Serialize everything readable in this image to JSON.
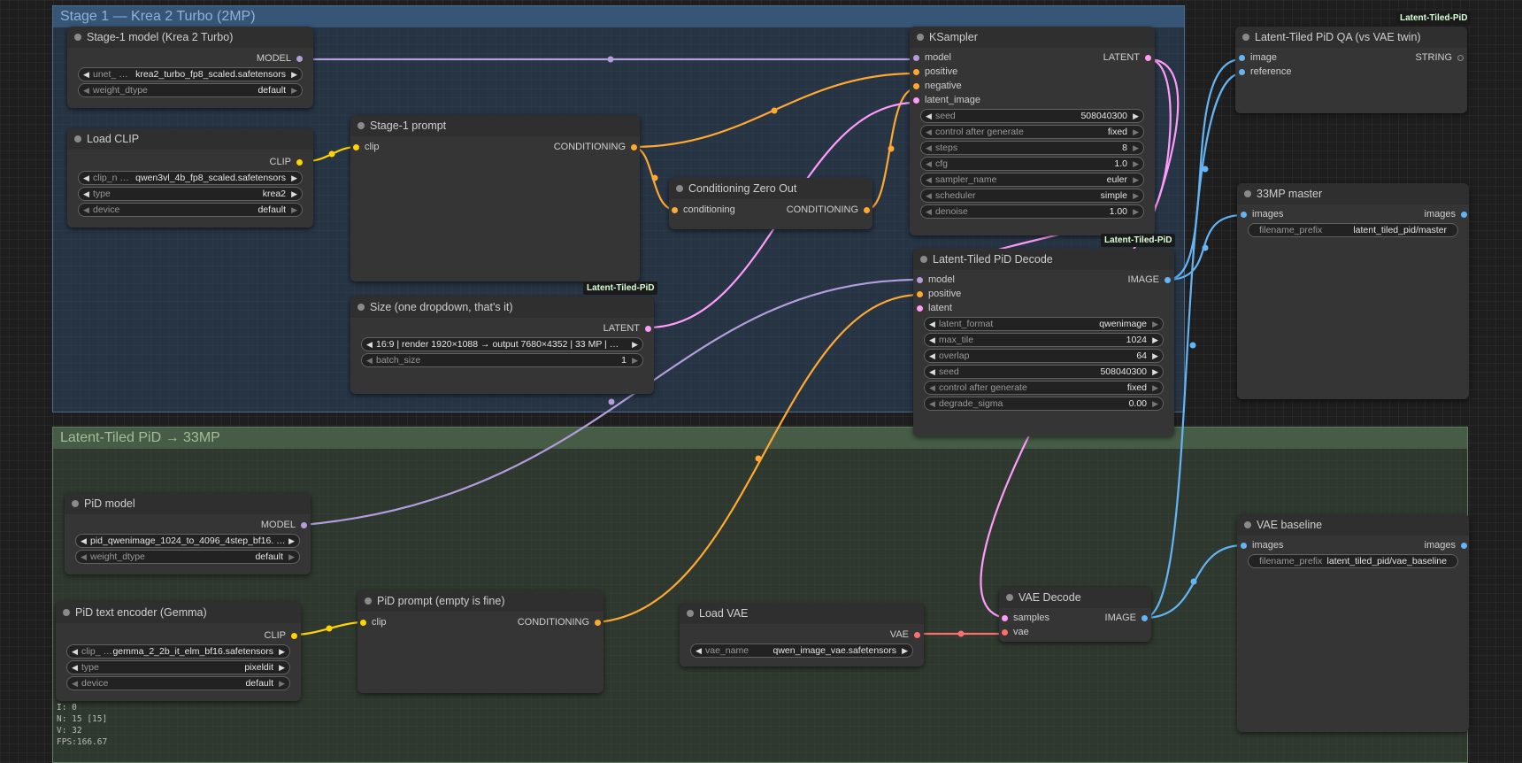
{
  "colors": {
    "model": "#b39ddb",
    "conditioning": "#ffa931",
    "latent": "#ff9cf9",
    "clip": "#ffd500",
    "vae": "#ff6e6e",
    "image": "#64b5f6",
    "string": "#777777"
  },
  "groups": {
    "stage1": "Stage 1 — Krea 2 Turbo (2MP)",
    "pid": "Latent-Tiled PiD → 33MP"
  },
  "icons": {
    "arrow_left": "◀",
    "arrow_right": "▶"
  },
  "badges": {
    "stage1_prompt": "Latent-Tiled-PiD",
    "ksampler": "Latent-Tiled-PiD",
    "qa": "Latent-Tiled-PiD"
  },
  "nodes": {
    "stage1_model": {
      "title": "Stage-1 model (Krea 2 Turbo)",
      "out_model": "MODEL",
      "unet_name": "unet_ …",
      "unet_value": "krea2_turbo_fp8_scaled.safetensors",
      "weight_dtype_label": "weight_dtype",
      "weight_dtype_value": "default"
    },
    "load_clip": {
      "title": "Load CLIP",
      "out_clip": "CLIP",
      "clip_name": "clip_n …",
      "clip_value": "qwen3vl_4b_fp8_scaled.safetensors",
      "type_label": "type",
      "type_value": "krea2",
      "device_label": "device",
      "device_value": "default"
    },
    "stage1_prompt": {
      "title": "Stage-1 prompt",
      "in_clip": "clip",
      "out_conditioning": "CONDITIONING"
    },
    "cond_zero": {
      "title": "Conditioning Zero Out",
      "in_conditioning": "conditioning",
      "out_conditioning": "CONDITIONING"
    },
    "size": {
      "title": "Size (one dropdown, that's it)",
      "out_latent": "LATENT",
      "preset": "16:9 | render 1920×1088 → output 7680×4352 | 33 MP | …",
      "batch_label": "batch_size",
      "batch_value": "1"
    },
    "ksampler": {
      "title": "KSampler",
      "in_model": "model",
      "in_positive": "positive",
      "in_negative": "negative",
      "in_latent": "latent_image",
      "out_latent": "LATENT",
      "widgets": [
        {
          "label": "seed",
          "value": "508040300"
        },
        {
          "label": "control after generate",
          "value": "fixed"
        },
        {
          "label": "steps",
          "value": "8"
        },
        {
          "label": "cfg",
          "value": "1.0"
        },
        {
          "label": "sampler_name",
          "value": "euler"
        },
        {
          "label": "scheduler",
          "value": "simple"
        },
        {
          "label": "denoise",
          "value": "1.00"
        }
      ]
    },
    "pid_decode": {
      "title": "Latent-Tiled PiD Decode",
      "in_model": "model",
      "in_positive": "positive",
      "in_latent": "latent",
      "out_image": "IMAGE",
      "widgets": [
        {
          "label": "latent_format",
          "value": "qwenimage"
        },
        {
          "label": "max_tile",
          "value": "1024"
        },
        {
          "label": "overlap",
          "value": "64"
        },
        {
          "label": "seed",
          "value": "508040300"
        },
        {
          "label": "control after generate",
          "value": "fixed"
        },
        {
          "label": "degrade_sigma",
          "value": "0.00"
        }
      ]
    },
    "qa": {
      "title": "Latent-Tiled PiD QA (vs VAE twin)",
      "in_image": "image",
      "in_reference": "reference",
      "out_string": "STRING"
    },
    "master": {
      "title": "33MP master",
      "in_images": "images",
      "out_images": "images",
      "prefix_label": "filename_prefix",
      "prefix_value": "latent_tiled_pid/master"
    },
    "pid_model": {
      "title": "PiD model",
      "out_model": "MODEL",
      "model_value": "pid_qwenimage_1024_to_4096_4step_bf16. …",
      "weight_dtype_label": "weight_dtype",
      "weight_dtype_value": "default"
    },
    "pid_text": {
      "title": "PiD text encoder (Gemma)",
      "out_clip": "CLIP",
      "clip_name": "clip_ …",
      "clip_value": "gemma_2_2b_it_elm_bf16.safetensors",
      "type_label": "type",
      "type_value": "pixeldit",
      "device_label": "device",
      "device_value": "default"
    },
    "pid_prompt": {
      "title": "PiD prompt (empty is fine)",
      "in_clip": "clip",
      "out_conditioning": "CONDITIONING"
    },
    "load_vae": {
      "title": "Load VAE",
      "out_vae": "VAE",
      "vae_label": "vae_name",
      "vae_value": "qwen_image_vae.safetensors"
    },
    "vae_decode": {
      "title": "VAE Decode",
      "in_samples": "samples",
      "in_vae": "vae",
      "out_image": "IMAGE"
    },
    "vae_baseline": {
      "title": "VAE baseline",
      "in_images": "images",
      "out_images": "images",
      "prefix_label": "filename_prefix",
      "prefix_value": "latent_tiled_pid/vae_baseline"
    }
  },
  "stats": {
    "i": "I: 0",
    "n": "N: 15 [15]",
    "v": "V: 32",
    "fps": "FPS:166.67"
  }
}
